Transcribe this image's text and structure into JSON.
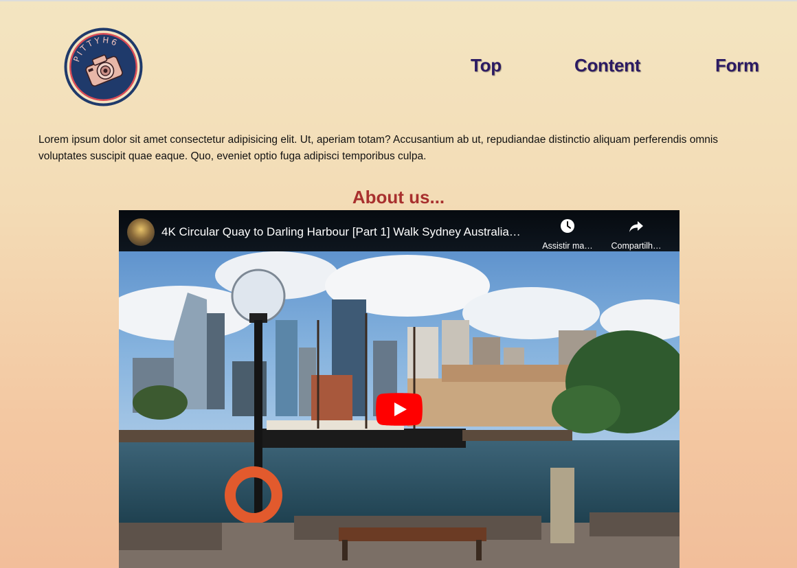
{
  "header": {
    "logo_text": "PITTYH6",
    "nav": [
      {
        "label": "Top"
      },
      {
        "label": "Content"
      },
      {
        "label": "Form"
      }
    ]
  },
  "intro": {
    "text": "Lorem ipsum dolor sit amet consectetur adipisicing elit. Ut, aperiam totam? Accusantium ab ut, repudiandae distinctio aliquam perferendis omnis voluptates suscipit quae eaque. Quo, eveniet optio fuga adipisci temporibus culpa."
  },
  "about": {
    "heading": "About us..."
  },
  "video": {
    "title": "4K Circular Quay to Darling Harbour [Part 1] Walk Sydney Australia…",
    "watch_later_label": "Assistir ma…",
    "share_label": "Compartilh…",
    "icons": {
      "watch_later": "clock-icon",
      "share": "share-icon",
      "play": "play-icon"
    }
  },
  "colors": {
    "nav_text": "#2b1a63",
    "heading": "#a8302e",
    "logo_ring": "#1f3a6b",
    "logo_inner_ring": "#d94c57",
    "play_red": "#ff0000"
  }
}
